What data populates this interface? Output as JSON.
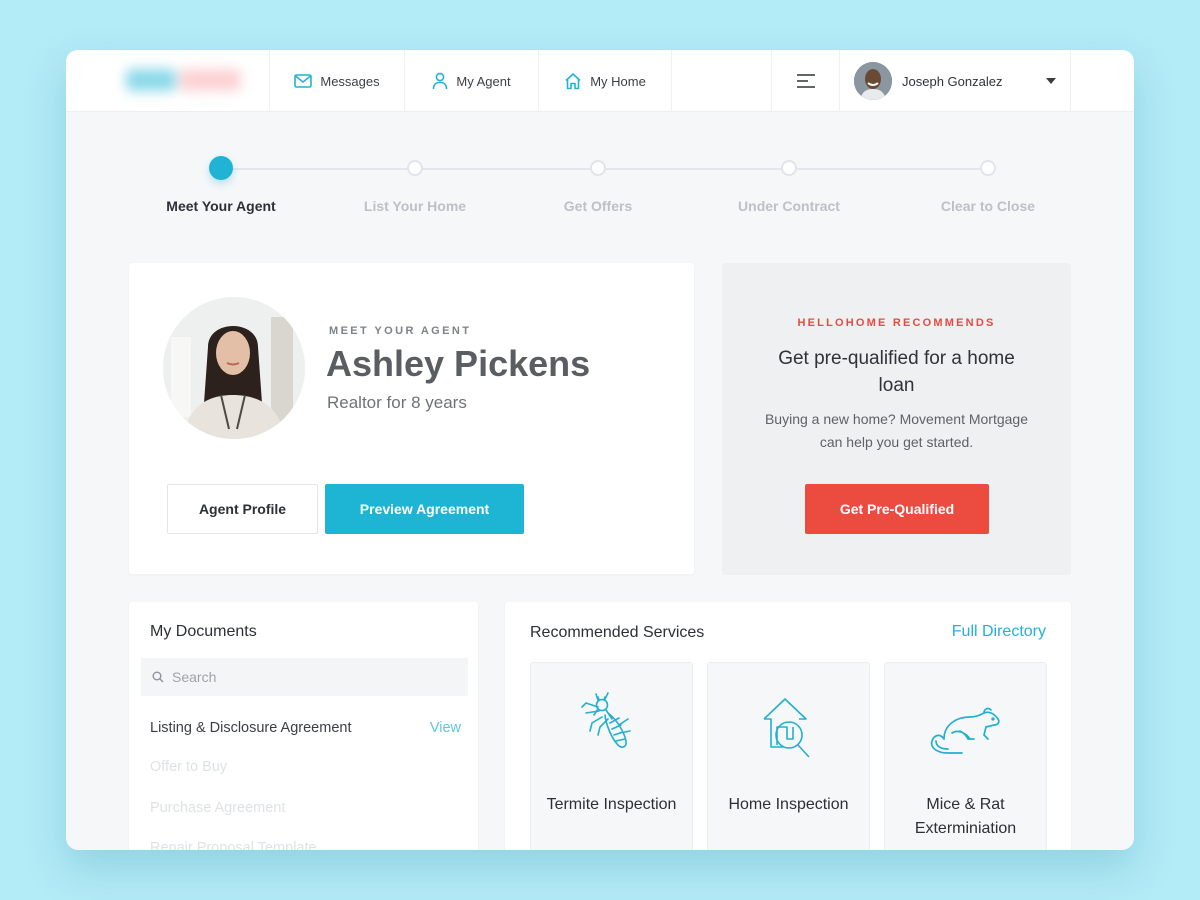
{
  "nav": {
    "logo_alt": "HelloHome",
    "items": [
      {
        "label": "Messages",
        "icon": "envelope-icon"
      },
      {
        "label": "My Agent",
        "icon": "user-icon"
      },
      {
        "label": "My Home",
        "icon": "home-icon"
      }
    ],
    "menu_icon": "hamburger-menu-icon",
    "user": {
      "name": "Joseph Gonzalez",
      "dropdown_icon": "caret-down-icon"
    }
  },
  "stepper": {
    "active_index": 0,
    "steps": [
      {
        "label": "Meet Your Agent"
      },
      {
        "label": "List Your Home"
      },
      {
        "label": "Get Offers"
      },
      {
        "label": "Under Contract"
      },
      {
        "label": "Clear to Close"
      }
    ]
  },
  "agent": {
    "eyebrow": "MEET YOUR AGENT",
    "name": "Ashley Pickens",
    "subtitle": "Realtor for 8 years",
    "profile_button": "Agent Profile",
    "preview_button": "Preview Agreement"
  },
  "promo": {
    "eyebrow": "HELLOHOME RECOMMENDS",
    "title": "Get pre-qualified for a home loan",
    "text": "Buying a new home? Movement Mortgage can help you get started.",
    "button": "Get Pre-Qualified"
  },
  "documents": {
    "title": "My Documents",
    "search_placeholder": "Search",
    "items": [
      {
        "name": "Listing & Disclosure Agreement",
        "action": "View",
        "available": true
      },
      {
        "name": "Offer to Buy",
        "available": false
      },
      {
        "name": "Purchase Agreement",
        "available": false
      },
      {
        "name": "Repair Proposal Template",
        "available": false
      }
    ]
  },
  "services": {
    "title": "Recommended Services",
    "link": "Full Directory",
    "items": [
      {
        "label": "Termite Inspection",
        "icon": "termite-icon"
      },
      {
        "label": "Home Inspection",
        "icon": "home-inspection-icon"
      },
      {
        "label": "Mice & Rat Exterminiation",
        "icon": "rat-icon"
      }
    ]
  },
  "colors": {
    "accent": "#1eb4d4",
    "promo_red": "#ec4b40",
    "background": "#b3ebf6"
  }
}
